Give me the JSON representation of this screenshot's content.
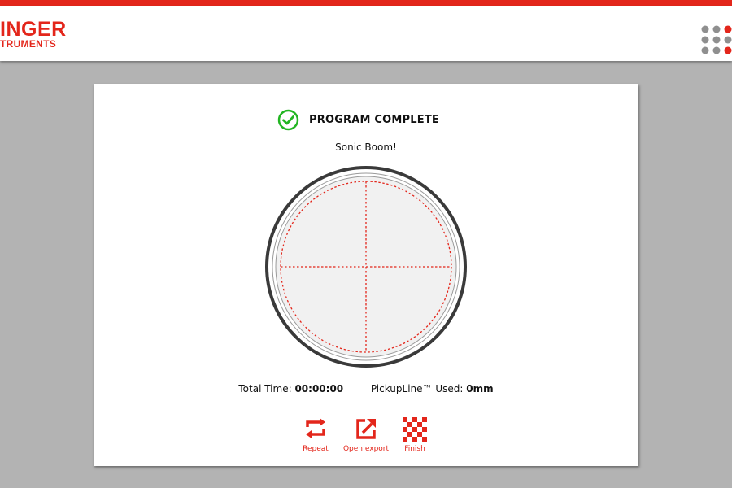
{
  "brand": {
    "logo_line1": "INGER",
    "logo_line2": "TRUMENTS",
    "accent_color": "#e3261b"
  },
  "header": {
    "menu_icon": "grid-dots-icon"
  },
  "status": {
    "icon": "check-circle-icon",
    "icon_color": "#22b522",
    "title": "PROGRAM COMPLETE"
  },
  "program": {
    "name": "Sonic Boom!"
  },
  "stats": {
    "total_time_label": "Total Time:",
    "total_time_value": "00:00:00",
    "pickupline_label": "PickupLine™ Used:",
    "pickupline_value": "0mm"
  },
  "actions": [
    {
      "label": "Repeat",
      "icon": "repeat-icon"
    },
    {
      "label": "Open export",
      "icon": "open-export-icon"
    },
    {
      "label": "Finish",
      "icon": "checkered-flag-icon"
    }
  ]
}
